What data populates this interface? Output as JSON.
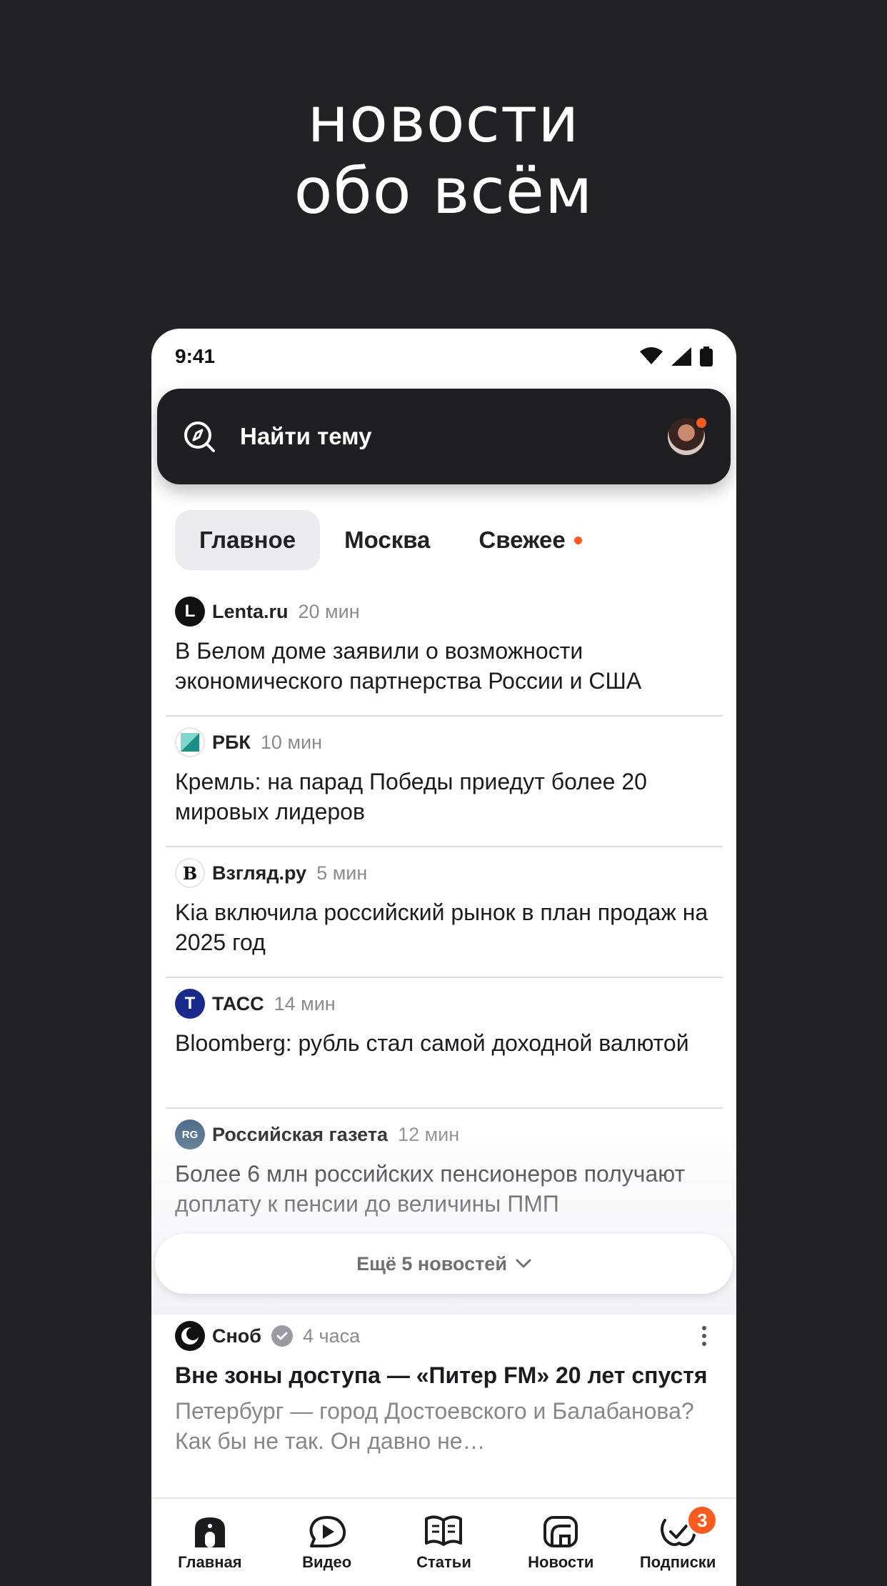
{
  "hero": {
    "line1": "новости",
    "line2": "обо всём"
  },
  "status_bar": {
    "time": "9:41"
  },
  "search": {
    "label": "Найти тему"
  },
  "tabs": [
    {
      "label": "Главное",
      "active": true
    },
    {
      "label": "Москва",
      "active": false
    },
    {
      "label": "Свежее",
      "active": false,
      "indicator": true
    }
  ],
  "news": [
    {
      "source": "Lenta.ru",
      "time": "20 мин",
      "logo": "L",
      "headline": "В Белом доме заявили о возможности экономического партнерства России и США"
    },
    {
      "source": "РБК",
      "time": "10 мин",
      "logo": "",
      "headline": "Кремль: на парад Победы приедут более 20 мировых лидеров"
    },
    {
      "source": "Взгляд.ру",
      "time": "5 мин",
      "logo": "B",
      "headline": "Kia включила российский рынок в план продаж на 2025 год"
    },
    {
      "source": "ТАСС",
      "time": "14 мин",
      "logo": "T",
      "headline": "Bloomberg: рубль стал самой доходной валютой"
    },
    {
      "source": "Российская газета",
      "time": "12 мин",
      "logo": "RG",
      "headline": "Более 6 млн российских пенсионеров получают доплату к пенсии до величины ПМП"
    }
  ],
  "more_button": {
    "label": "Ещё 5 новостей"
  },
  "article": {
    "source": "Сноб",
    "time": "4 часа",
    "title": "Вне зоны доступа — «Питер FM» 20 лет спустя",
    "snippet": "Петербург — город Достоевского и Балабанова? Как бы не так. Он давно не…"
  },
  "bottom_nav": [
    {
      "label": "Главная",
      "icon": "home-icon"
    },
    {
      "label": "Видео",
      "icon": "play-icon"
    },
    {
      "label": "Статьи",
      "icon": "book-icon"
    },
    {
      "label": "Новости",
      "icon": "news-icon"
    },
    {
      "label": "Подписки",
      "icon": "subscriptions-icon",
      "badge": "3"
    }
  ],
  "colors": {
    "accent": "#ff5a1f",
    "dark": "#1f1f21",
    "background": "#222224"
  }
}
